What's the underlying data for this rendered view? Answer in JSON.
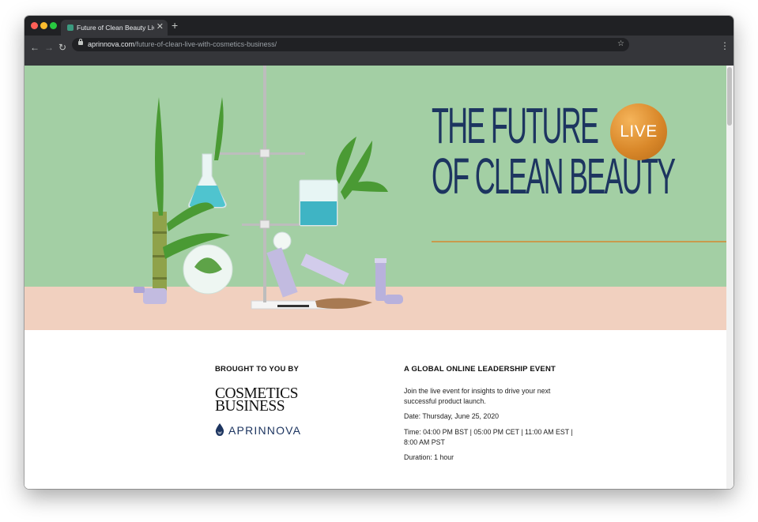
{
  "browser": {
    "tab_title": "Future of Clean Beauty Live Wi",
    "new_tab_glyph": "+",
    "url_host": "aprinnova.com",
    "url_path": "/future-of-clean-live-with-cosmetics-business/",
    "icons": [
      "close-icon",
      "plus-icon",
      "back-arrow-icon",
      "forward-arrow-icon",
      "reload-icon",
      "lock-icon",
      "star-icon",
      "kebab-menu-icon"
    ]
  },
  "hero": {
    "headline_line1": "THE FUTURE",
    "headline_line2": "OF CLEAN BEAUTY",
    "badge": "LIVE",
    "colors": {
      "mint_background": "#a3cfa4",
      "peach_surface": "#f1d0bf",
      "navy_text": "#1d3560",
      "gold_accent": "#c89a4d"
    }
  },
  "info": {
    "left_heading": "BROUGHT TO YOU BY",
    "cosmetics_logo_line1": "COSMETICS",
    "cosmetics_logo_line2": "BUSINESS",
    "aprinnova_logo": "APRINNOVA",
    "right_heading": "A GLOBAL ONLINE LEADERSHIP EVENT",
    "intro": "Join the live event for insights to drive your next successful product launch.",
    "date_label": "Date:",
    "date_value": "Thursday, June 25, 2020",
    "time_label": "Time:",
    "time_value": "04:00 PM BST | 05:00 PM CET | 11:00 AM EST | 8:00 AM PST",
    "duration_label": "Duration:",
    "duration_value": "1 hour"
  }
}
